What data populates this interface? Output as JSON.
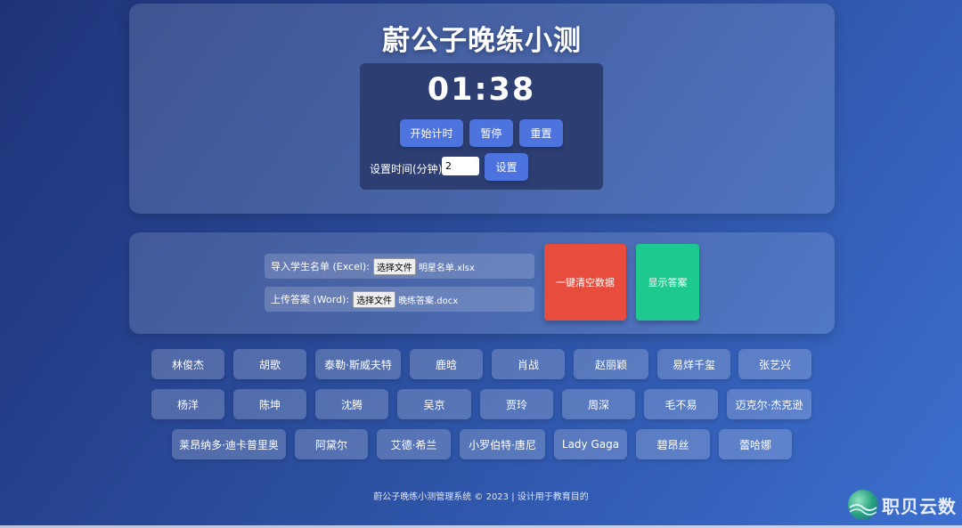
{
  "title": "蔚公子晚练小测",
  "timer": {
    "display": "01:38",
    "start_label": "开始计时",
    "pause_label": "暂停",
    "reset_label": "重置",
    "set_time_label": "设置时间(分钟):",
    "set_time_value": "2",
    "set_button_label": "设置"
  },
  "uploads": {
    "students_label": "导入学生名单 (Excel):",
    "students_button": "选择文件",
    "students_file": "明星名单.xlsx",
    "answers_label": "上传答案 (Word):",
    "answers_button": "选择文件",
    "answers_file": "晚练答案.docx"
  },
  "actions": {
    "clear_label": "一键清空数据",
    "clear_color": "#e74c3c",
    "show_answer_label": "显示答案",
    "show_answer_color": "#1ec98f"
  },
  "students": {
    "row1": [
      "林俊杰",
      "胡歌",
      "泰勒·斯威夫特",
      "鹿晗",
      "肖战",
      "赵丽颖",
      "易烊千玺",
      "张艺兴"
    ],
    "row2": [
      "杨洋",
      "陈坤",
      "沈腾",
      "吴京",
      "贾玲",
      "周深",
      "毛不易",
      "迈克尔·杰克逊"
    ],
    "row3": [
      "莱昂纳多·迪卡普里奥",
      "阿黛尔",
      "艾德·希兰",
      "小罗伯特·唐尼",
      "Lady Gaga",
      "碧昂丝",
      "蕾哈娜"
    ]
  },
  "footer": "蔚公子晚练小测管理系统 © 2023 | 设计用于教育目的",
  "watermark": {
    "text": "职贝云数",
    "icon": "globe-logo-icon"
  },
  "colors": {
    "accent": "#4d73df",
    "timer_bg": "#2c3e72"
  }
}
